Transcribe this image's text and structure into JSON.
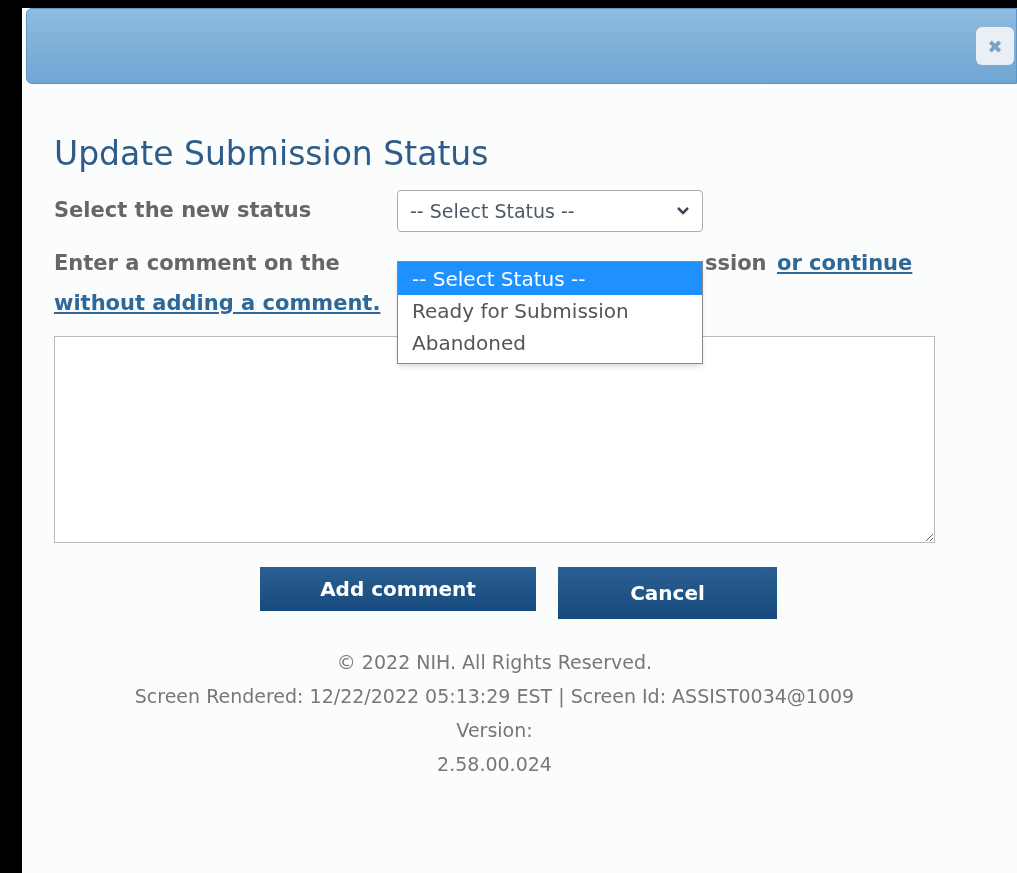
{
  "dialog": {
    "title": "Update Submission Status",
    "close_label": "✖"
  },
  "status_field": {
    "label": "Select the new status",
    "value": "-- Select Status --",
    "options": [
      {
        "label": "-- Select Status --",
        "selected": true
      },
      {
        "label": "Ready for Submission",
        "selected": false
      },
      {
        "label": "Abandoned",
        "selected": false
      }
    ]
  },
  "comment": {
    "label_start": "Enter a comment on the",
    "label_end": "ssion",
    "link_line1": "or continue",
    "link_line2": "without adding a comment."
  },
  "buttons": [
    "Add comment",
    "Cancel"
  ],
  "footer": [
    "© 2022 NIH. All Rights Reserved.",
    "Screen Rendered: 12/22/2022 05:13:29 EST | Screen Id: ASSIST0034@1009",
    "Version:",
    "2.58.00.024"
  ]
}
